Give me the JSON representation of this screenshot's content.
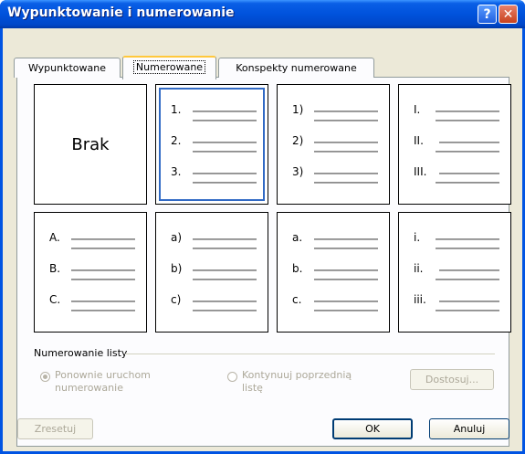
{
  "window": {
    "title": "Wypunktowanie i numerowanie",
    "help_glyph": "?",
    "close_glyph": "✕"
  },
  "tabs": [
    {
      "label": "Wypunktowane"
    },
    {
      "label": "Numerowane"
    },
    {
      "label": "Konspekty numerowane"
    }
  ],
  "gallery": {
    "none_label": "Brak",
    "cells": [
      {
        "labels": [
          "1.",
          "2.",
          "3."
        ]
      },
      {
        "labels": [
          "1)",
          "2)",
          "3)"
        ]
      },
      {
        "labels": [
          "I.",
          "II.",
          "III."
        ]
      },
      {
        "labels": [
          "A.",
          "B.",
          "C."
        ]
      },
      {
        "labels": [
          "a)",
          "b)",
          "c)"
        ]
      },
      {
        "labels": [
          "a.",
          "b.",
          "c."
        ]
      },
      {
        "labels": [
          "i.",
          "ii.",
          "iii."
        ]
      }
    ]
  },
  "list_numbering": {
    "section_label": "Numerowanie listy",
    "restart_line1": "Ponownie uruchom",
    "restart_line2": "numerowanie",
    "continue_line1": "Kontynuuj poprzednią",
    "continue_line2": "listę",
    "customize_label": "Dostosuj..."
  },
  "footer": {
    "reset_label": "Zresetuj",
    "ok_label": "OK",
    "cancel_label": "Anuluj"
  }
}
